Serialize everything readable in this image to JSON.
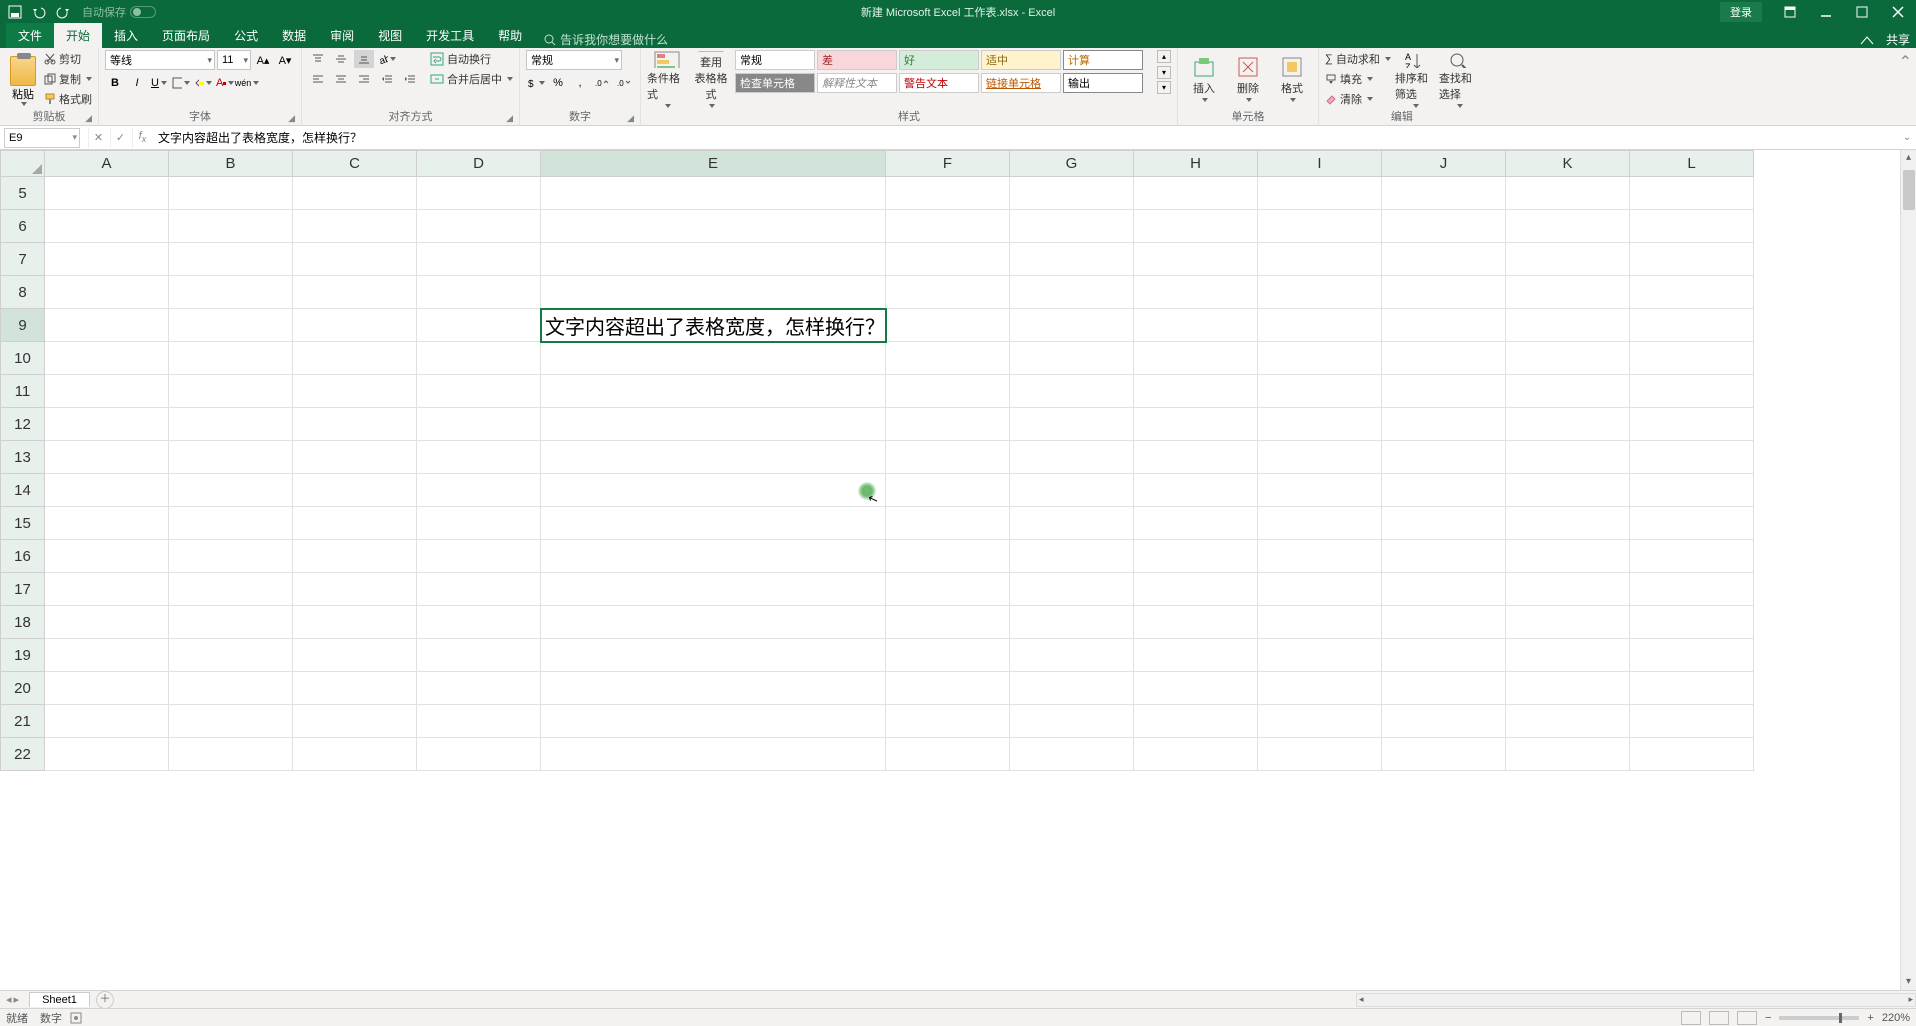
{
  "titlebar": {
    "autosave_label": "自动保存",
    "title": "新建 Microsoft Excel 工作表.xlsx - Excel",
    "login": "登录"
  },
  "tabs": {
    "file": "文件",
    "items": [
      "开始",
      "插入",
      "页面布局",
      "公式",
      "数据",
      "审阅",
      "视图",
      "开发工具",
      "帮助"
    ],
    "active_index": 0,
    "search_placeholder": "告诉我你想要做什么",
    "share": "共享"
  },
  "ribbon": {
    "clipboard": {
      "label": "剪贴板",
      "paste": "粘贴",
      "cut": "剪切",
      "copy": "复制",
      "format_painter": "格式刷"
    },
    "font": {
      "label": "字体",
      "name": "等线",
      "size": "11"
    },
    "alignment": {
      "label": "对齐方式",
      "wrap": "自动换行",
      "merge": "合并后居中"
    },
    "number": {
      "label": "数字",
      "format": "常规"
    },
    "styles": {
      "label": "样式",
      "cond": "条件格式",
      "table": "套用\n表格格式",
      "gallery": [
        {
          "t": "常规",
          "c": "sc-normal"
        },
        {
          "t": "差",
          "c": "sc-bad"
        },
        {
          "t": "好",
          "c": "sc-good"
        },
        {
          "t": "适中",
          "c": "sc-neutral"
        },
        {
          "t": "计算",
          "c": "sc-calc"
        },
        {
          "t": "检查单元格",
          "c": "sc-check"
        },
        {
          "t": "解释性文本",
          "c": "sc-explan"
        },
        {
          "t": "警告文本",
          "c": "sc-warn"
        },
        {
          "t": "链接单元格",
          "c": "sc-link"
        },
        {
          "t": "输出",
          "c": "sc-output"
        }
      ]
    },
    "cells": {
      "label": "单元格",
      "insert": "插入",
      "delete": "删除",
      "format": "格式"
    },
    "editing": {
      "label": "编辑",
      "autosum": "自动求和",
      "fill": "填充",
      "clear": "清除",
      "sort": "排序和筛选",
      "find": "查找和选择"
    }
  },
  "namebox": "E9",
  "formula": "文字内容超出了表格宽度，怎样换行？",
  "columns": [
    "A",
    "B",
    "C",
    "D",
    "E",
    "F",
    "G",
    "H",
    "I",
    "J",
    "K",
    "L"
  ],
  "rows": [
    5,
    6,
    7,
    8,
    9,
    10,
    11,
    12,
    13,
    14,
    15,
    16,
    17,
    18,
    19,
    20,
    21,
    22
  ],
  "active": {
    "col": "E",
    "row": 9
  },
  "cell_text": "文字内容超出了表格宽度，怎样换行？",
  "sheet": {
    "name": "Sheet1"
  },
  "status": {
    "ready": "就绪",
    "num": "数字",
    "zoom": "220%"
  }
}
